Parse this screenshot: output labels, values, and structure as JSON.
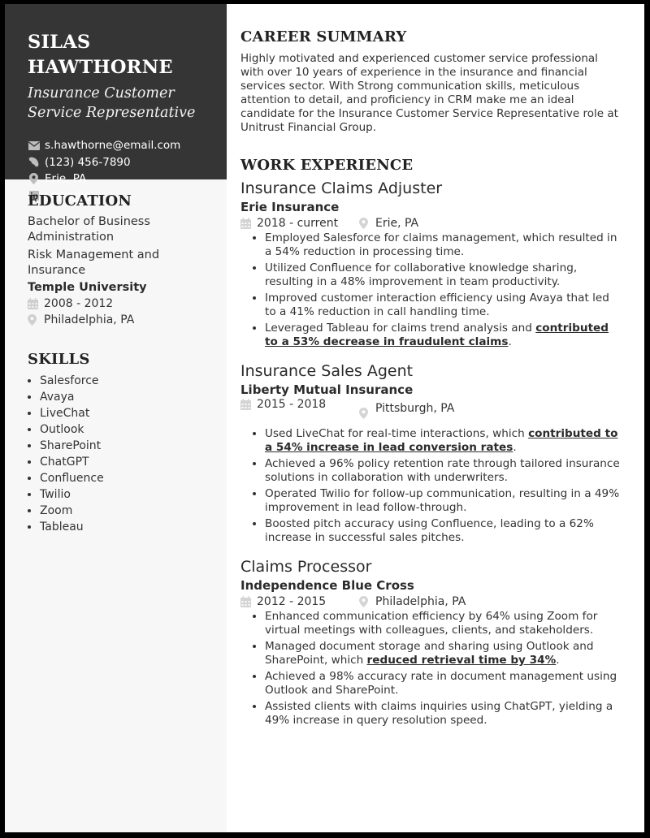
{
  "header": {
    "first_name": "SILAS",
    "last_name": "HAWTHORNE",
    "title_line1": "Insurance Customer",
    "title_line2": "Service Representative",
    "contacts": {
      "email": "s.hawthorne@email.com",
      "phone": "(123) 456-7890",
      "location": "Erie, PA",
      "linkedin": "LinkedIn"
    }
  },
  "education": {
    "heading": "EDUCATION",
    "degree": "Bachelor of Business Administration",
    "major": "Risk Management and Insurance",
    "school": "Temple University",
    "dates": "2008 - 2012",
    "location": "Philadelphia, PA"
  },
  "skills": {
    "heading": "SKILLS",
    "items": [
      "Salesforce",
      "Avaya",
      "LiveChat",
      "Outlook",
      "SharePoint",
      "ChatGPT",
      "Confluence",
      "Twilio",
      "Zoom",
      "Tableau"
    ]
  },
  "summary": {
    "heading": "CAREER SUMMARY",
    "text": "Highly motivated and experienced customer service professional with over 10 years of experience in the insurance and financial services sector. With Strong communication skills, meticulous attention to detail, and proficiency in CRM make me an ideal candidate for the Insurance Customer Service Representative role at Unitrust Financial Group."
  },
  "work": {
    "heading": "WORK EXPERIENCE",
    "jobs": [
      {
        "title": "Insurance Claims Adjuster",
        "company": "Erie Insurance",
        "dates": "2018 - current",
        "location": "Erie, PA",
        "bullets": [
          {
            "pre": "Employed Salesforce for claims management, which resulted in a 54% reduction in processing time.",
            "bold": "",
            "post": ""
          },
          {
            "pre": "Utilized Confluence for collaborative knowledge sharing, resulting in a 48% improvement in team productivity.",
            "bold": "",
            "post": ""
          },
          {
            "pre": "Improved customer interaction efficiency using Avaya that led to a 41% reduction in call handling time.",
            "bold": "",
            "post": ""
          },
          {
            "pre": "Leveraged Tableau for claims trend analysis and ",
            "bold": "contributed to a 53% decrease in fraudulent claims",
            "post": "."
          }
        ]
      },
      {
        "title": "Insurance Sales Agent",
        "company": "Liberty Mutual Insurance",
        "dates": "2015 - 2018",
        "location": "Pittsburgh, PA",
        "bullets": [
          {
            "pre": "Used LiveChat for real-time interactions, which ",
            "bold": "contributed to a 54% increase in lead conversion rates",
            "post": "."
          },
          {
            "pre": "Achieved a 96% policy retention rate through tailored insurance solutions in collaboration with underwriters.",
            "bold": "",
            "post": ""
          },
          {
            "pre": "Operated Twilio for follow-up communication, resulting in a 49% improvement in lead follow-through.",
            "bold": "",
            "post": ""
          },
          {
            "pre": "Boosted pitch accuracy using Confluence, leading to a 62% increase in successful sales pitches.",
            "bold": "",
            "post": ""
          }
        ]
      },
      {
        "title": "Claims Processor",
        "company": "Independence Blue Cross",
        "dates": "2012 - 2015",
        "location": "Philadelphia, PA",
        "bullets": [
          {
            "pre": "Enhanced communication efficiency by 64% using Zoom for virtual meetings with colleagues, clients, and stakeholders.",
            "bold": "",
            "post": ""
          },
          {
            "pre": "Managed document storage and sharing using Outlook and SharePoint, which ",
            "bold": "reduced retrieval time by 34%",
            "post": "."
          },
          {
            "pre": "Achieved a 98% accuracy rate in document management using Outlook and SharePoint.",
            "bold": "",
            "post": ""
          },
          {
            "pre": "Assisted clients with claims inquiries using ChatGPT, yielding a 49% increase in query resolution speed.",
            "bold": "",
            "post": ""
          }
        ]
      }
    ]
  }
}
